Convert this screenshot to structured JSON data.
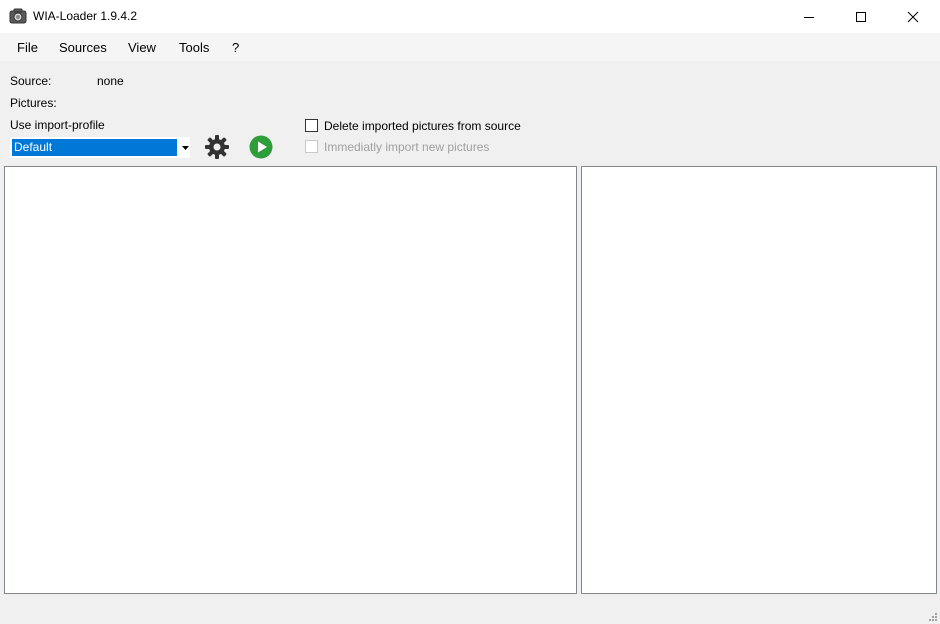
{
  "window": {
    "title": "WIA-Loader 1.9.4.2",
    "icon": "camera-icon"
  },
  "menu": {
    "items": [
      {
        "label": "File"
      },
      {
        "label": "Sources"
      },
      {
        "label": "View"
      },
      {
        "label": "Tools"
      },
      {
        "label": "?"
      }
    ]
  },
  "form": {
    "source_label": "Source:",
    "source_value": "none",
    "pictures_label": "Pictures:",
    "profile_label": "Use import-profile",
    "profile_selected": "Default",
    "settings_icon": "gear-icon",
    "start_icon": "play-icon",
    "start_color": "#2e9e3a",
    "delete_checkbox_label": "Delete imported pictures from source",
    "delete_checked": false,
    "immediate_checkbox_label": "Immediatly import new pictures",
    "immediate_checked": false,
    "immediate_enabled": false
  },
  "colors": {
    "selection": "#0078d7",
    "panel_border": "#828790"
  }
}
